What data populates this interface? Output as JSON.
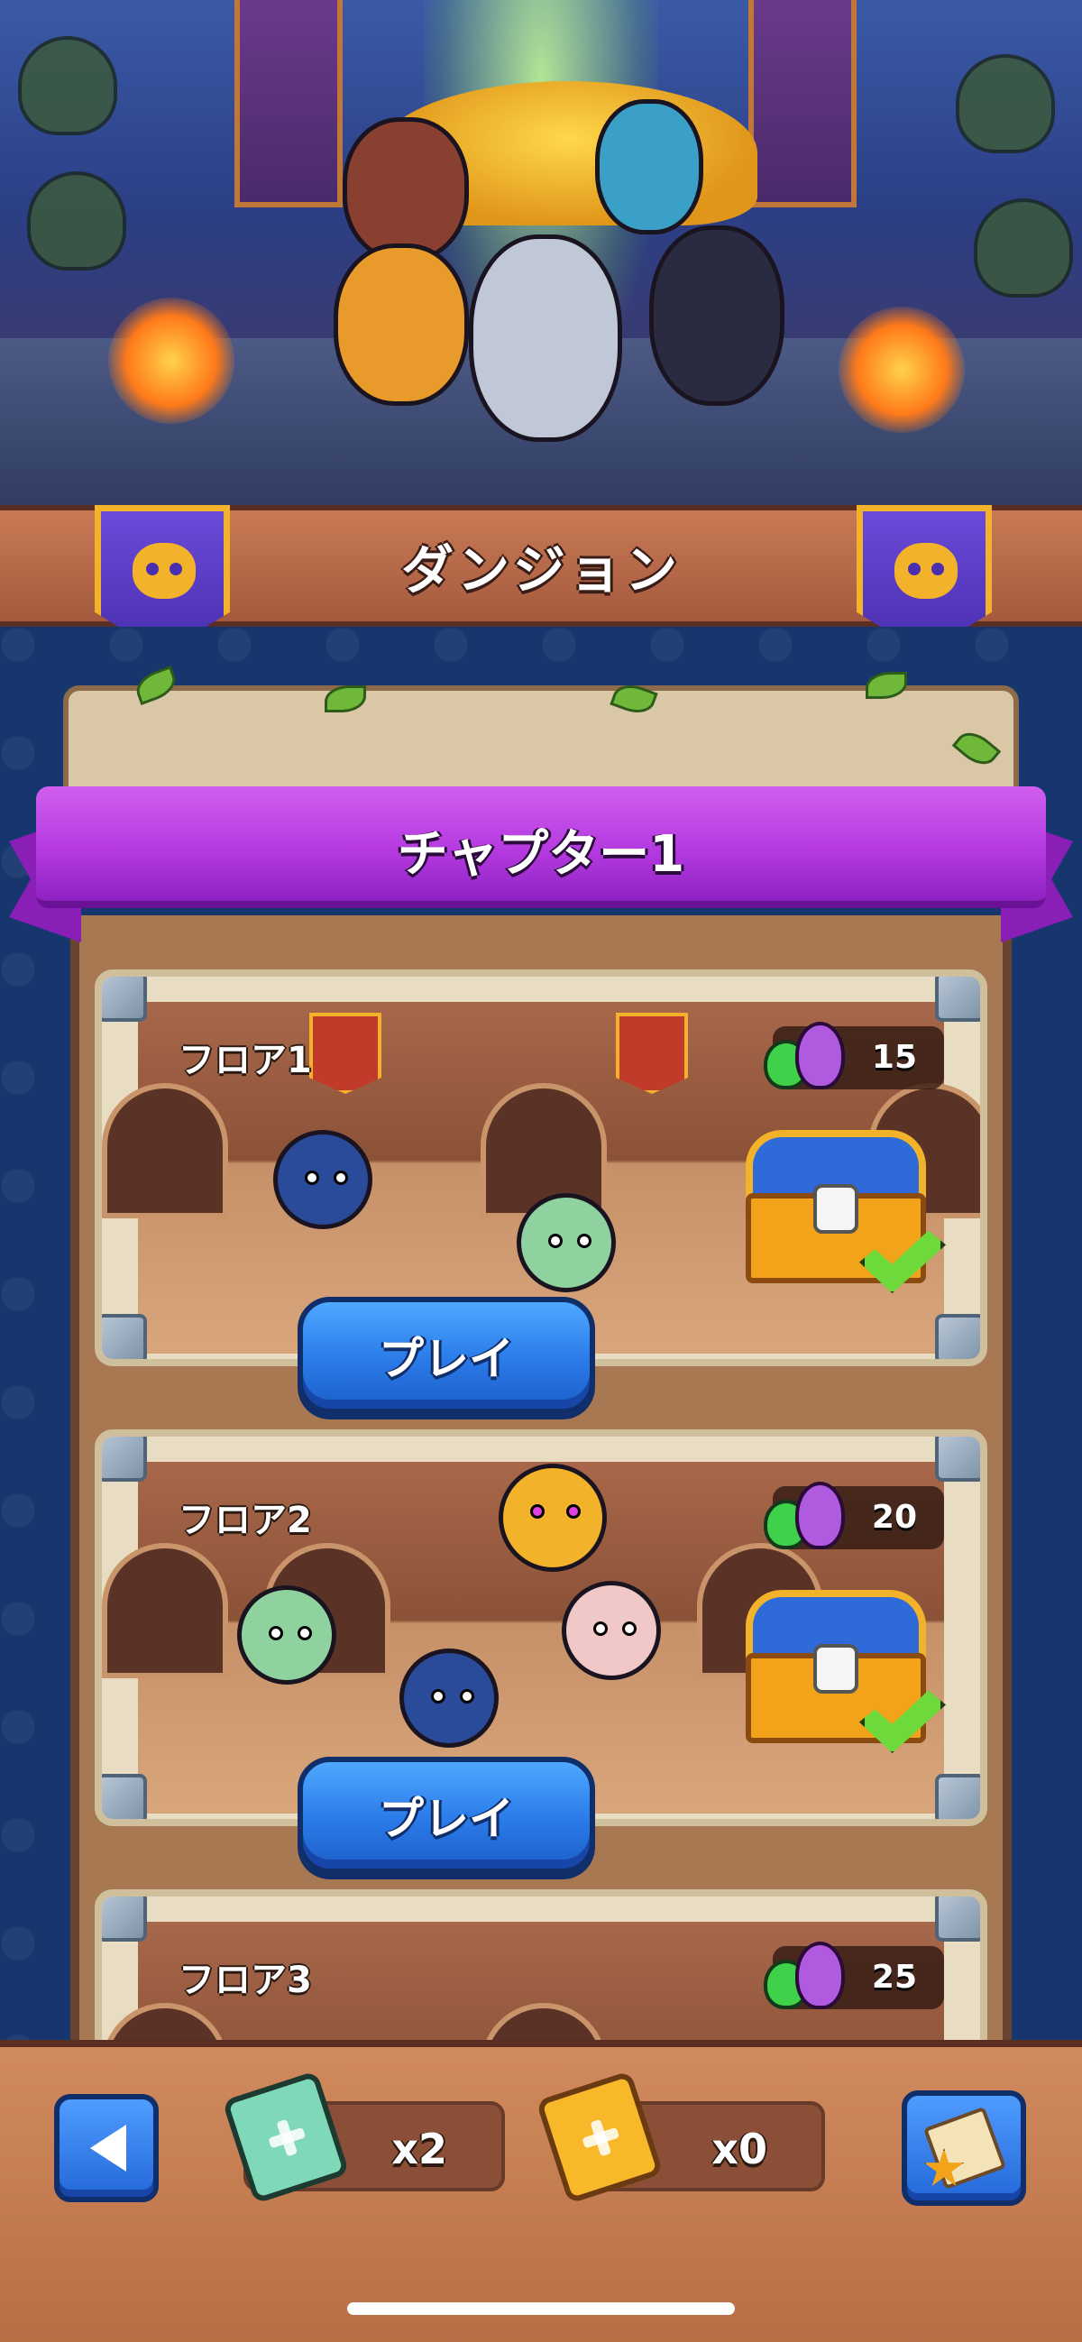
{
  "header": {
    "title": "ダンジョン",
    "left_emblem": "skull-shield-icon",
    "right_emblem": "skull-shield-icon"
  },
  "chapter": {
    "title": "チャプター1"
  },
  "floors": [
    {
      "label": "フロア1",
      "reward_count": "15",
      "button_label": "プレイ",
      "completed": true
    },
    {
      "label": "フロア2",
      "reward_count": "20",
      "button_label": "プレイ",
      "completed": true
    },
    {
      "label": "フロア3",
      "reward_count": "25"
    }
  ],
  "bottom_bar": {
    "back_icon": "back-arrow-icon",
    "green_ticket_count": "x2",
    "gold_ticket_count": "x0",
    "quest_icon": "scroll-star-icon"
  },
  "colors": {
    "accent_purple": "#b53be0",
    "button_blue": "#2a7ae8",
    "wood": "#b86e45",
    "check_green": "#6ed93a"
  }
}
